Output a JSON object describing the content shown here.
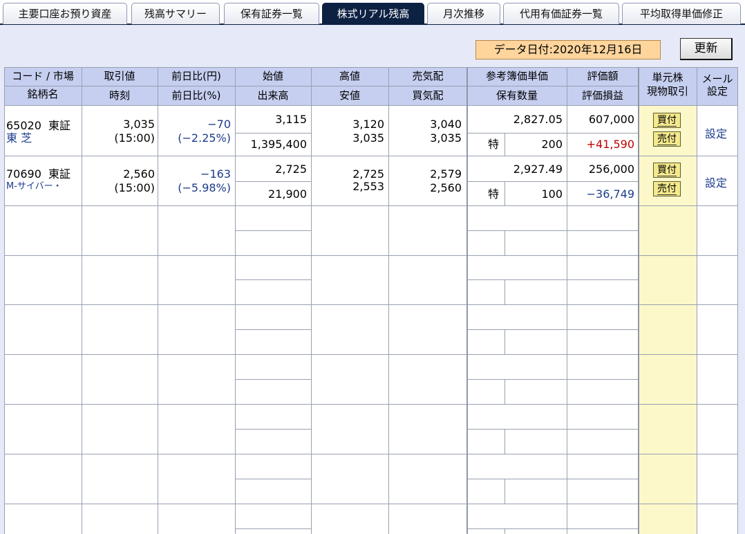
{
  "tabs": [
    {
      "label": "主要口座お預り資産",
      "active": false
    },
    {
      "label": "残高サマリー",
      "active": false
    },
    {
      "label": "保有証券一覧",
      "active": false
    },
    {
      "label": "株式リアル残高",
      "active": true
    },
    {
      "label": "月次推移",
      "active": false
    },
    {
      "label": "代用有価証券一覧",
      "active": false
    },
    {
      "label": "平均取得単価修正",
      "active": false
    }
  ],
  "data_date": "データ日付:2020年12月16日",
  "refresh_label": "更新",
  "headers": {
    "code_market": "コード / 市場",
    "stock_name": "銘柄名",
    "price": "取引値",
    "time": "時刻",
    "change_yen": "前日比(円)",
    "change_pct": "前日比(%)",
    "open": "始値",
    "volume": "出来高",
    "high": "高値",
    "low": "安値",
    "ask": "売気配",
    "bid": "買気配",
    "ref_cost": "参考簿価単価",
    "holdings": "保有数量",
    "valuation": "評価額",
    "gain_loss": "評価損益",
    "unit_line1": "単元株",
    "unit_line2": "現物取引",
    "mail_line1": "メール",
    "mail_line2": "設定"
  },
  "rows": [
    {
      "code": "65020",
      "market": "東証",
      "name": "東 芝",
      "price": "3,035",
      "time": "(15:00)",
      "change": "−70",
      "change_pct": "(−2.25%)",
      "open": "3,115",
      "volume": "1,395,400",
      "high": "3,120",
      "low": "3,035",
      "ask": "3,040",
      "bid": "3,035",
      "ref_cost": "2,827.05",
      "account_type": "特",
      "quantity": "200",
      "valuation": "607,000",
      "gain_loss": "+41,590",
      "buy_label": "買付",
      "sell_label": "売付",
      "mail_label": "設定"
    },
    {
      "code": "70690",
      "market": "東証",
      "name": "M-サイバー・",
      "price": "2,560",
      "time": "(15:00)",
      "change": "−163",
      "change_pct": "(−5.98%)",
      "open": "2,725",
      "volume": "21,900",
      "high": "2,725",
      "low": "2,553",
      "ask": "2,579",
      "bid": "2,560",
      "ref_cost": "2,927.49",
      "account_type": "特",
      "quantity": "100",
      "valuation": "256,000",
      "gain_loss": "−36,749",
      "buy_label": "買付",
      "sell_label": "売付",
      "mail_label": "設定"
    }
  ]
}
